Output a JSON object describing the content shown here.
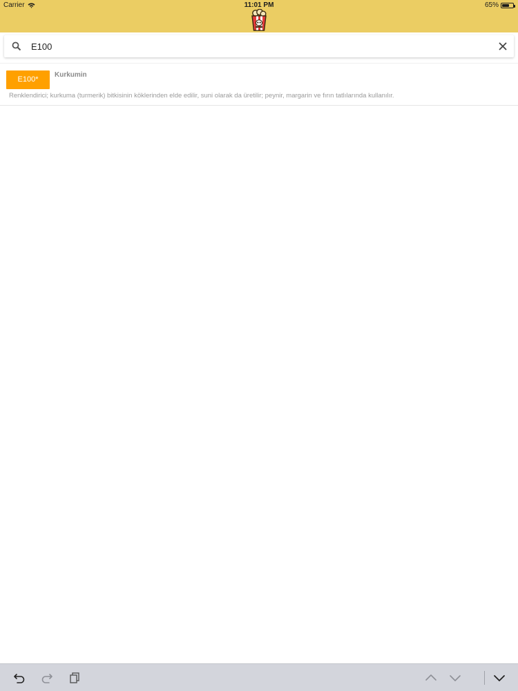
{
  "status_bar": {
    "carrier": "Carrier",
    "time": "11:01 PM",
    "battery": "65%",
    "battery_level": 0.65,
    "wifi_icon": "wifi-icon",
    "battery_icon": "battery-icon"
  },
  "header": {
    "background_color": "#ebcd63",
    "logo_icon": "popcorn-box-skull-icon"
  },
  "search": {
    "value": "E100",
    "search_icon": "search-icon",
    "clear_icon": "close-icon"
  },
  "results": [
    {
      "code": "E100*",
      "name": "Kurkumin",
      "description": "Renklendirici; kurkuma (turmerik) bitkisinin köklerinden elde edilir, suni olarak da üretilir; peynir, margarin ve fırın tatlılarında kullanılır.",
      "badge_color": "#ffa000"
    }
  ],
  "keyboard_toolbar": {
    "undo_icon": "undo-icon",
    "redo_icon": "redo-icon",
    "paste_icon": "paste-icon",
    "previous_icon": "chevron-up-icon",
    "next_icon": "chevron-down-icon",
    "dismiss_icon": "keyboard-dismiss-icon"
  }
}
